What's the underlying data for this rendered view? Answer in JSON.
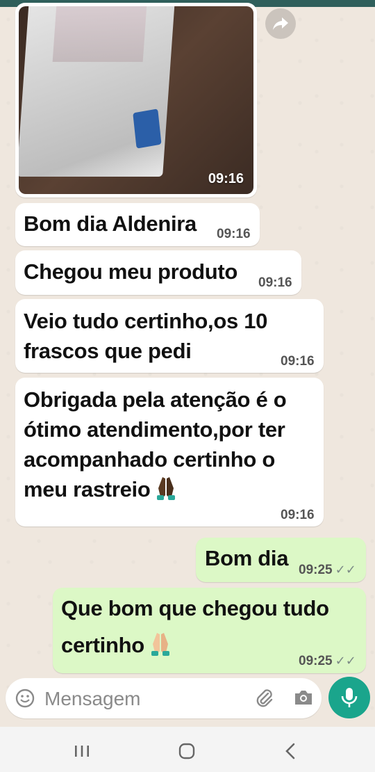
{
  "messages": [
    {
      "text": "Bom dia Aldenira",
      "time": "09:16"
    },
    {
      "text": "Chegou meu produto",
      "time": "09:16"
    },
    {
      "text_lines": [
        "Veio tudo certinho,os 10",
        "frascos que pedi"
      ],
      "time": "09:16"
    },
    {
      "text_lines": [
        "Obrigada pela atenção é o",
        "ótimo atendimento,por ter",
        "acompanhado certinho o",
        "meu rastreio"
      ],
      "time": "09:16"
    },
    {
      "text": "Bom dia",
      "time": "09:25"
    },
    {
      "text_lines": [
        "Que bom que chegou tudo",
        "certinho"
      ],
      "time": "09:25"
    }
  ],
  "image_message": {
    "time": "09:16"
  },
  "input": {
    "placeholder": "Mensagem"
  },
  "icons": {
    "forward": "forward-icon",
    "emoji": "emoji-icon",
    "attach": "paperclip-icon",
    "camera": "camera-icon",
    "mic": "mic-icon",
    "read_receipt": "double-check-icon"
  },
  "colors": {
    "incoming_bubble": "#ffffff",
    "outgoing_bubble": "#dcf8c6",
    "chat_background": "#efe7de",
    "mic_button": "#1aa58c"
  }
}
